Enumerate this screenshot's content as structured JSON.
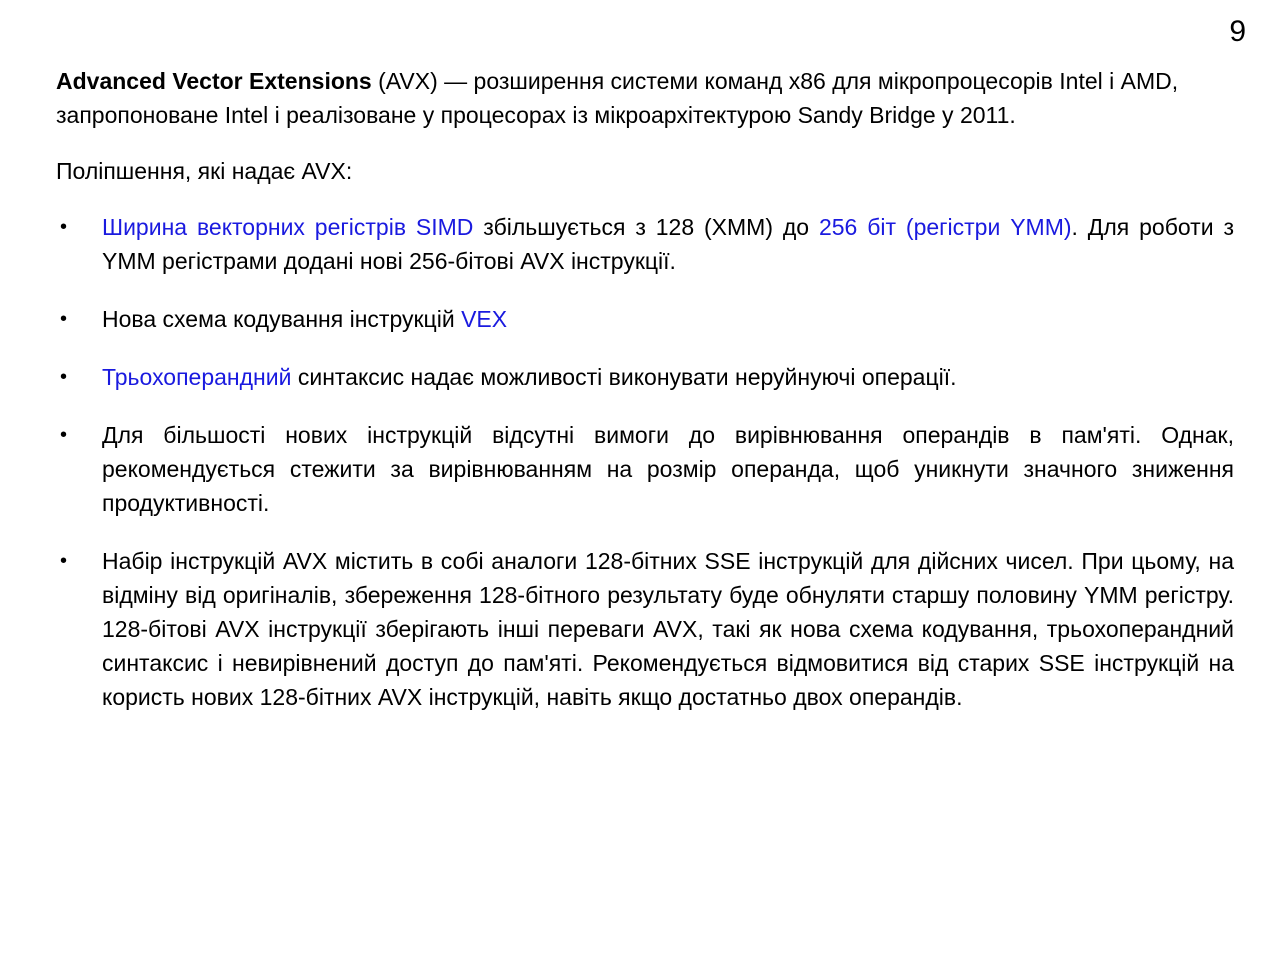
{
  "page_number": "9",
  "intro": {
    "term": "Advanced Vector Extensions",
    "text": " (AVX) — розширення системи команд x86 для мікропроцесорів Intel і AMD, запропоноване Intel і реалізоване у процесорах із мікроархітектурою Sandy Bridge у 2011."
  },
  "lead": "Поліпшення, які надає AVX:",
  "bullet_symbol": "•",
  "bullets": [
    {
      "link1": "Ширина векторних регістрів SIMD",
      "text1": " збільшується з 128 (XMM) до ",
      "link2": "256 біт (регістри YMM)",
      "text2": ". Для роботи з YMM регістрами додані нові 256-бітові AVX інструкції."
    },
    {
      "text1": "Нова схема кодування інструкцій ",
      "link1": "VEX"
    },
    {
      "link1": "Трьохоперандний",
      "text1": " синтаксис надає можливості виконувати неруйнуючі операції."
    },
    {
      "text1": "Для більшості нових інструкцій відсутні вимоги до вирівнювання операндів в пам'яті. Однак, рекомендується стежити за вирівнюванням на розмір операнда, щоб уникнути значного зниження продуктивності."
    },
    {
      "text1": "Набір інструкцій AVX містить в собі аналоги 128-бітних SSE інструкцій для дійсних чисел. При цьому, на відміну від оригіналів, збереження 128-бітного результату буде обнуляти старшу половину YMM регістру. 128-бітові AVX інструкції зберігають інші переваги AVX, такі як нова схема кодування, трьохоперандний синтаксис і невирівнений доступ до пам'яті. Рекомендується відмовитися від старих SSE інструкцій на користь нових 128-бітних AVX інструкцій, навіть якщо достатньо двох операндів."
    }
  ],
  "colors": {
    "link": "#1a1adf",
    "text": "#000000",
    "background": "#ffffff"
  }
}
